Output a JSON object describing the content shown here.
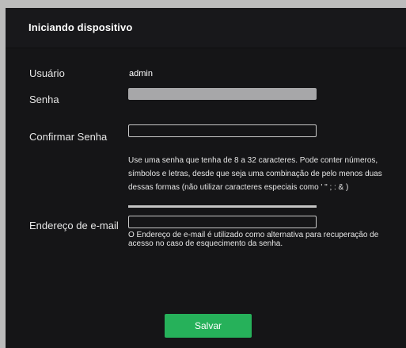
{
  "dialog": {
    "title": "Iniciando dispositivo"
  },
  "form": {
    "user_label": "Usuário",
    "user_value": "admin",
    "password_label": "Senha",
    "password_value": "",
    "confirm_label": "Confirmar Senha",
    "confirm_value": "",
    "password_hint": "Use uma senha que tenha de 8 a 32 caracteres. Pode conter números, símbolos e letras, desde que seja uma combinação de pelo menos duas dessas formas (não utilizar caracteres especiais como ' \" ; : & )",
    "email_label": "Endereço de e-mail",
    "email_value": "",
    "email_hint": "O Endereço de e-mail é utilizado como alternativa para recuperação de acesso no caso de esquecimento da senha."
  },
  "actions": {
    "save_label": "Salvar"
  },
  "colors": {
    "background": "#151517",
    "accent": "#26b15a",
    "filled_input": "#a7a7a9"
  }
}
